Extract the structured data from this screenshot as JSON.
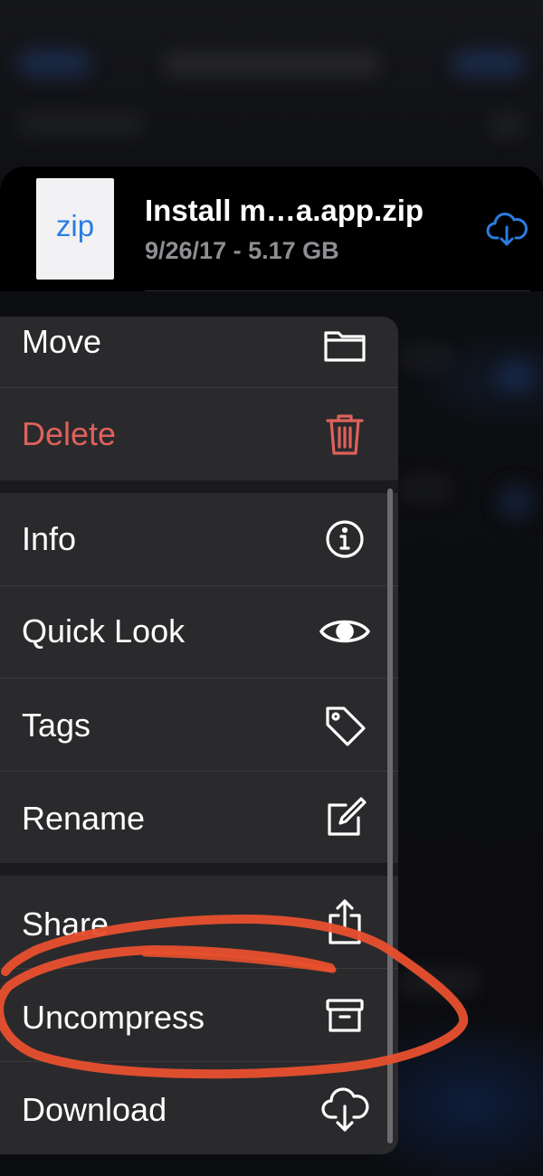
{
  "file": {
    "thumbnail_label": "zip",
    "name": "Install m…a.app.zip",
    "meta": "9/26/17 - 5.17 GB",
    "action_icon": "cloud-download-icon"
  },
  "menu": {
    "items": [
      {
        "label": "Move",
        "icon": "folder-icon"
      },
      {
        "label": "Delete",
        "icon": "trash-icon"
      },
      {
        "label": "Info",
        "icon": "info-icon"
      },
      {
        "label": "Quick Look",
        "icon": "eye-icon"
      },
      {
        "label": "Tags",
        "icon": "tag-icon"
      },
      {
        "label": "Rename",
        "icon": "pencil-square-icon"
      },
      {
        "label": "Share",
        "icon": "share-icon"
      },
      {
        "label": "Uncompress",
        "icon": "archive-box-icon"
      },
      {
        "label": "Download",
        "icon": "cloud-download-icon"
      }
    ]
  },
  "colors": {
    "accent": "#2a7de1",
    "destructive": "#e0615a",
    "annotation": "#e8502e"
  }
}
